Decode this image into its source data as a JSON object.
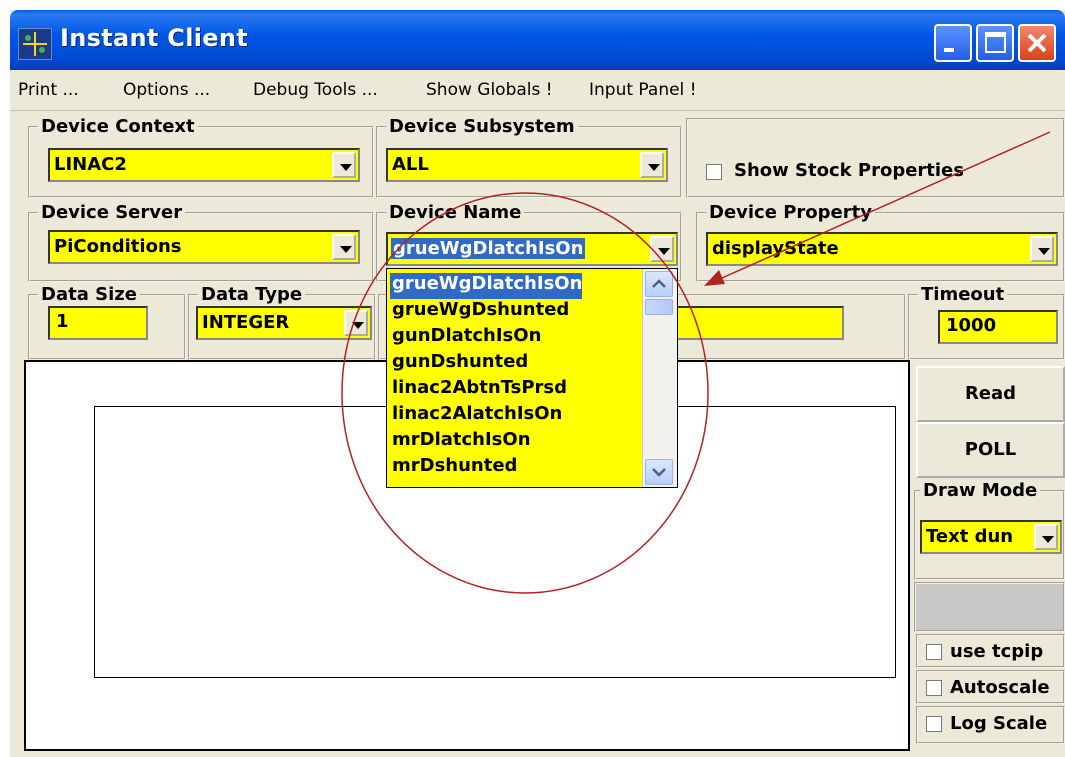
{
  "window": {
    "title": "Instant Client"
  },
  "menu": [
    "Print ...",
    "Options ...",
    "Debug Tools ...",
    "Show Globals !",
    "Input Panel !"
  ],
  "device_context": {
    "label": "Device Context",
    "value": "LINAC2"
  },
  "device_subsystem": {
    "label": "Device Subsystem",
    "value": "ALL"
  },
  "show_stock": {
    "label": "Show Stock Properties",
    "checked": false
  },
  "device_server": {
    "label": "Device Server",
    "value": "PiConditions"
  },
  "device_name": {
    "label": "Device Name",
    "value": "grueWgDlatchIsOn",
    "options": [
      "grueWgDlatchIsOn",
      "grueWgDshunted",
      "gunDlatchIsOn",
      "gunDshunted",
      "linac2AbtnTsPrsd",
      "linac2AlatchIsOn",
      "mrDlatchIsOn",
      "mrDshunted"
    ],
    "selected_index": 0
  },
  "device_property": {
    "label": "Device Property",
    "value": "displayState"
  },
  "data_size": {
    "label": "Data Size",
    "value": "1"
  },
  "data_type": {
    "label": "Data Type",
    "value": "INTEGER"
  },
  "timeout": {
    "label": "Timeout",
    "value": "1000"
  },
  "buttons": {
    "read": "Read",
    "poll": "POLL"
  },
  "draw_mode": {
    "label": "Draw Mode",
    "value": "Text dun"
  },
  "options": {
    "use_tcpip": "use tcpip",
    "autoscale": "Autoscale",
    "log_scale": "Log Scale"
  },
  "colors": {
    "field": "#ffff00",
    "selection": "#316ac5",
    "annotation": "#b22222",
    "titlebar": "#0058e6"
  }
}
